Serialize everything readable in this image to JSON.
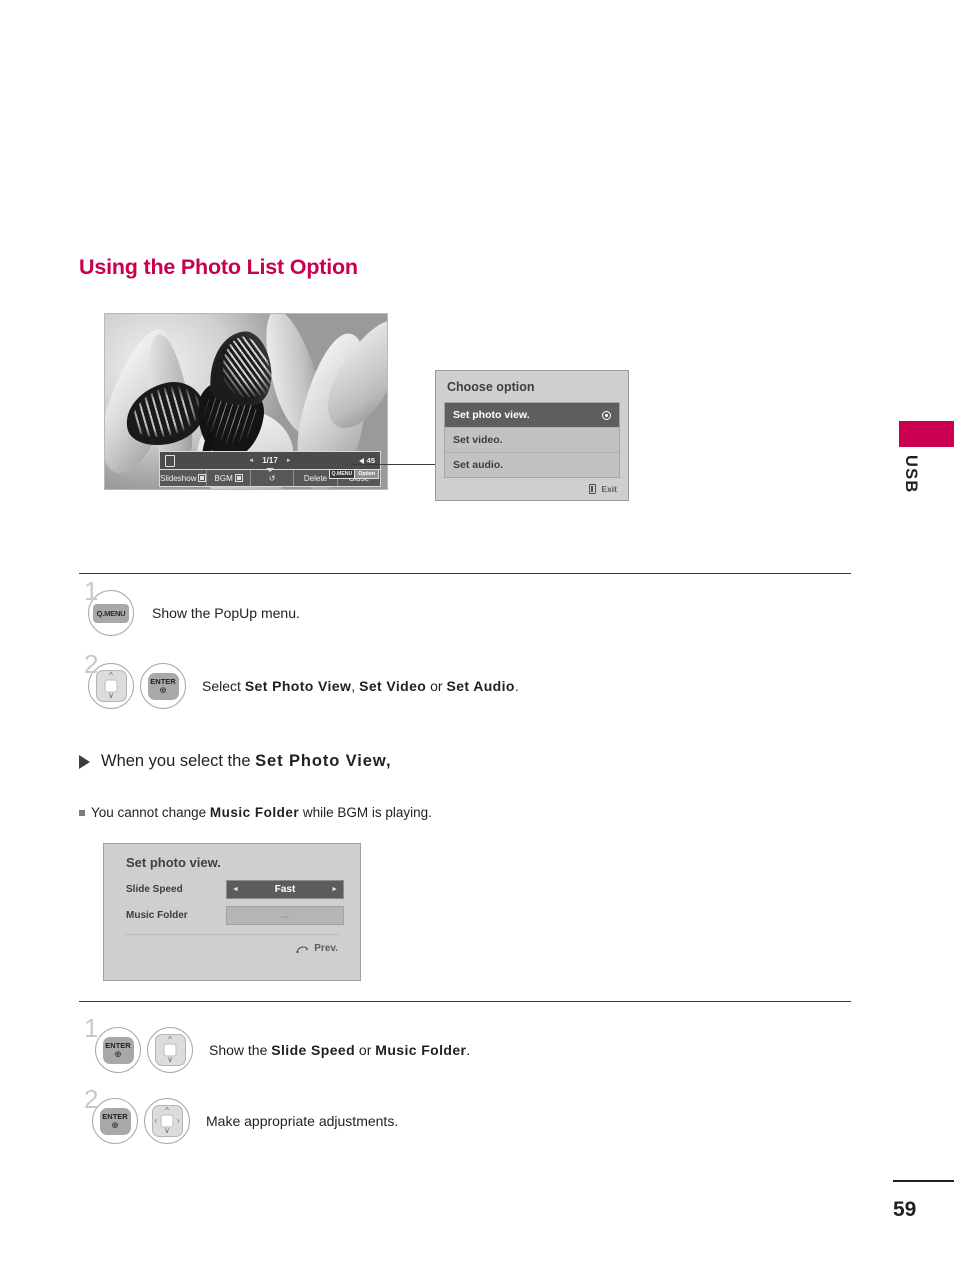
{
  "page": {
    "title": "Using the Photo List Option",
    "side_tab_label": "USB",
    "number": "59",
    "accent_color": "#c8004f"
  },
  "tv_screenshot": {
    "osd": {
      "counter": "1/17",
      "prev_arrow": "◄",
      "next_arrow": "►",
      "volume_value": "45",
      "qmenu_key": "Q.MENU",
      "qmenu_action": "Option",
      "buttons": [
        {
          "label": "Slideshow",
          "has_marker": true
        },
        {
          "label": "BGM",
          "has_marker": true
        },
        {
          "label": "↺",
          "has_marker": false
        },
        {
          "label": "Delete",
          "has_marker": false
        },
        {
          "label": "Close",
          "has_marker": false
        }
      ]
    }
  },
  "choose_option_dialog": {
    "title": "Choose option",
    "items": [
      {
        "label": "Set photo view.",
        "selected": true
      },
      {
        "label": "Set video.",
        "selected": false
      },
      {
        "label": "Set audio.",
        "selected": false
      }
    ],
    "footer_label": "Exit"
  },
  "steps_top": [
    {
      "number": "1",
      "keys": [
        {
          "type": "qmenu",
          "label": "Q.MENU"
        }
      ],
      "text_parts": [
        {
          "t": "Show the PopUp menu.",
          "bold": false
        }
      ]
    },
    {
      "number": "2",
      "keys": [
        {
          "type": "nav-ud",
          "label": ""
        },
        {
          "type": "enter",
          "label": "ENTER"
        }
      ],
      "text_parts": [
        {
          "t": "Select ",
          "bold": false
        },
        {
          "t": "Set Photo View",
          "bold": true
        },
        {
          "t": ", ",
          "bold": false
        },
        {
          "t": "Set Video",
          "bold": true
        },
        {
          "t": " or ",
          "bold": false
        },
        {
          "t": "Set Audio",
          "bold": true
        },
        {
          "t": ".",
          "bold": false
        }
      ]
    }
  ],
  "when_section": {
    "lead_parts": [
      {
        "t": "When you select the ",
        "bold": false
      },
      {
        "t": "Set Photo View,",
        "bold": true
      }
    ],
    "note_parts": [
      {
        "t": "You cannot change ",
        "bold": false
      },
      {
        "t": "Music Folder",
        "bold": true
      },
      {
        "t": " while BGM is playing.",
        "bold": false
      }
    ]
  },
  "set_photo_view_panel": {
    "title": "Set photo view.",
    "rows": [
      {
        "label": "Slide Speed",
        "value": "Fast",
        "active": true,
        "left_arrow": "◄",
        "right_arrow": "►"
      },
      {
        "label": "Music Folder",
        "value": "...",
        "active": false,
        "left_arrow": "",
        "right_arrow": ""
      }
    ],
    "footer_label": "Prev."
  },
  "steps_bottom": [
    {
      "number": "1",
      "keys": [
        {
          "type": "enter",
          "label": "ENTER"
        },
        {
          "type": "nav-ud",
          "label": ""
        }
      ],
      "text_parts": [
        {
          "t": "Show the ",
          "bold": false
        },
        {
          "t": "Slide Speed",
          "bold": true
        },
        {
          "t": " or ",
          "bold": false
        },
        {
          "t": "Music Folder",
          "bold": true
        },
        {
          "t": ".",
          "bold": false
        }
      ]
    },
    {
      "number": "2",
      "keys": [
        {
          "type": "enter",
          "label": "ENTER"
        },
        {
          "type": "nav-4",
          "label": ""
        }
      ],
      "text_parts": [
        {
          "t": "Make appropriate adjustments.",
          "bold": false
        }
      ]
    }
  ]
}
